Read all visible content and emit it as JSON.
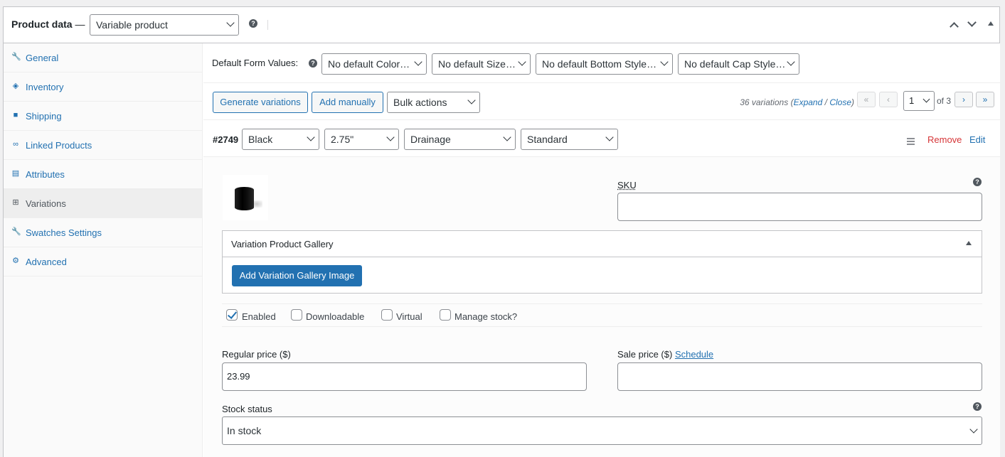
{
  "header": {
    "title": "Product data",
    "dash": "—",
    "product_type": "Variable product"
  },
  "sidebar": {
    "items": [
      {
        "label": "General",
        "icon": "wrench-icon",
        "active": false
      },
      {
        "label": "Inventory",
        "icon": "tag-icon",
        "active": false
      },
      {
        "label": "Shipping",
        "icon": "truck-icon",
        "active": false
      },
      {
        "label": "Linked Products",
        "icon": "link-icon",
        "active": false
      },
      {
        "label": "Attributes",
        "icon": "list-icon",
        "active": false
      },
      {
        "label": "Variations",
        "icon": "grid-icon",
        "active": true
      },
      {
        "label": "Swatches Settings",
        "icon": "wrench-icon",
        "active": false
      },
      {
        "label": "Advanced",
        "icon": "gear-icon",
        "active": false
      }
    ]
  },
  "defaults": {
    "label": "Default Form Values:",
    "selects": [
      "No default Color…",
      "No default Size…",
      "No default Bottom Style…",
      "No default Cap Style…"
    ]
  },
  "toolbar": {
    "generate": "Generate variations",
    "add_manually": "Add manually",
    "bulk": "Bulk actions",
    "count_text": "36 variations",
    "expand": "Expand",
    "slash": "/",
    "close": "Close",
    "first": "«",
    "prev": "‹",
    "page": "1",
    "of": "of 3",
    "next": "›",
    "last": "»"
  },
  "variation": {
    "id": "#2749",
    "attrs": [
      "Black",
      "2.75\"",
      "Drainage",
      "Standard"
    ],
    "remove": "Remove",
    "edit": "Edit",
    "sku_label": "SKU",
    "sku_value": "",
    "gallery_title": "Variation Product Gallery",
    "gallery_button": "Add Variation Gallery Image",
    "checks": [
      {
        "label": "Enabled",
        "checked": true
      },
      {
        "label": "Downloadable",
        "checked": false
      },
      {
        "label": "Virtual",
        "checked": false
      },
      {
        "label": "Manage stock?",
        "checked": false
      }
    ],
    "regular_price_label": "Regular price ($)",
    "regular_price": "23.99",
    "sale_price_label": "Sale price ($)",
    "schedule": "Schedule",
    "sale_price": "",
    "stock_status_label": "Stock status",
    "stock_status": "In stock"
  },
  "colors": {
    "accent": "#2271b1",
    "danger": "#d63638"
  }
}
